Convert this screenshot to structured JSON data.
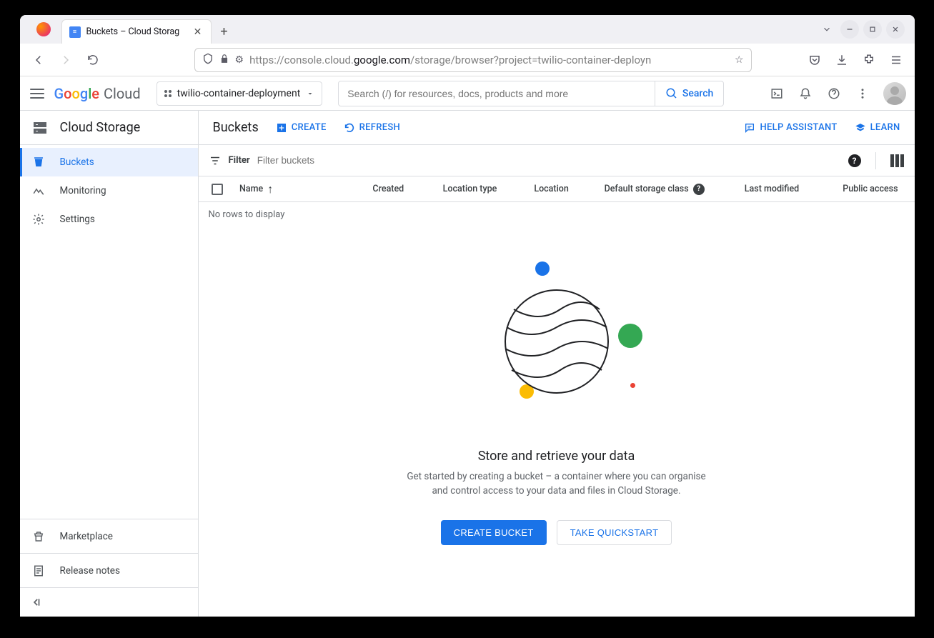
{
  "browser": {
    "tab_title": "Buckets – Cloud Storag",
    "url_prefix": "https://console.cloud.",
    "url_domain": "google.com",
    "url_path": "/storage/browser?project=twilio-container-deployn"
  },
  "header": {
    "logo_text": "oogle",
    "logo_cloud": "Cloud",
    "project": "twilio-container-deployment",
    "search_placeholder": "Search (/) for resources, docs, products and more",
    "search_button": "Search"
  },
  "sidebar": {
    "title": "Cloud Storage",
    "items": [
      {
        "label": "Buckets"
      },
      {
        "label": "Monitoring"
      },
      {
        "label": "Settings"
      }
    ],
    "footer": [
      {
        "label": "Marketplace"
      },
      {
        "label": "Release notes"
      }
    ]
  },
  "page": {
    "title": "Buckets",
    "create": "CREATE",
    "refresh": "REFRESH",
    "help_assistant": "HELP ASSISTANT",
    "learn": "LEARN"
  },
  "filter": {
    "label": "Filter",
    "placeholder": "Filter buckets"
  },
  "table": {
    "columns": {
      "name": "Name",
      "created": "Created",
      "location_type": "Location type",
      "location": "Location",
      "storage_class": "Default storage class",
      "last_modified": "Last modified",
      "public_access": "Public access"
    },
    "empty": "No rows to display"
  },
  "empty_state": {
    "title": "Store and retrieve your data",
    "description": "Get started by creating a bucket – a container where you can organise and control access to your data and files in Cloud Storage.",
    "create_bucket": "CREATE BUCKET",
    "take_quickstart": "TAKE QUICKSTART"
  }
}
